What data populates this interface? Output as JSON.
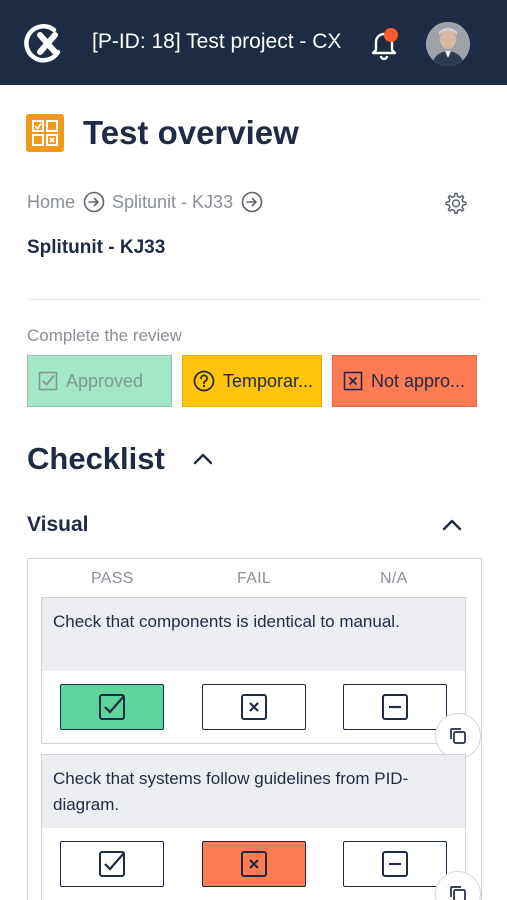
{
  "header": {
    "project_title": "[P-ID: 18] Test project - CX",
    "logo_icon": "app-logo-icon",
    "notification_icon": "bell-icon",
    "accent": "#ff5a2c",
    "background": "#1d2b45"
  },
  "page": {
    "title": "Test overview",
    "title_icon": "checklist-grid-icon",
    "title_icon_color": "#f19a19"
  },
  "breadcrumb": {
    "items": [
      "Home",
      "Splitunit - KJ33"
    ],
    "separator_icon": "arrow-right-circle-icon"
  },
  "subtitle": "Splitunit - KJ33",
  "settings_icon": "gear-icon",
  "review": {
    "label": "Complete the review",
    "buttons": [
      {
        "label": "Approved",
        "icon": "checkbox-check-icon",
        "color": "#a3e6c8"
      },
      {
        "label": "Temporar...",
        "icon": "question-circle-icon",
        "color": "#ffc30a"
      },
      {
        "label": "Not appro...",
        "icon": "checkbox-x-icon",
        "color": "#ff7b54"
      }
    ]
  },
  "checklist": {
    "title": "Checklist",
    "section": {
      "title": "Visual",
      "columns": [
        "PASS",
        "FAIL",
        "N/A"
      ],
      "items": [
        {
          "question": "Check that components is identical to manual.",
          "selected": "PASS"
        },
        {
          "question": "Check that systems follow guidelines from PID-diagram.",
          "selected": "FAIL"
        }
      ]
    }
  }
}
